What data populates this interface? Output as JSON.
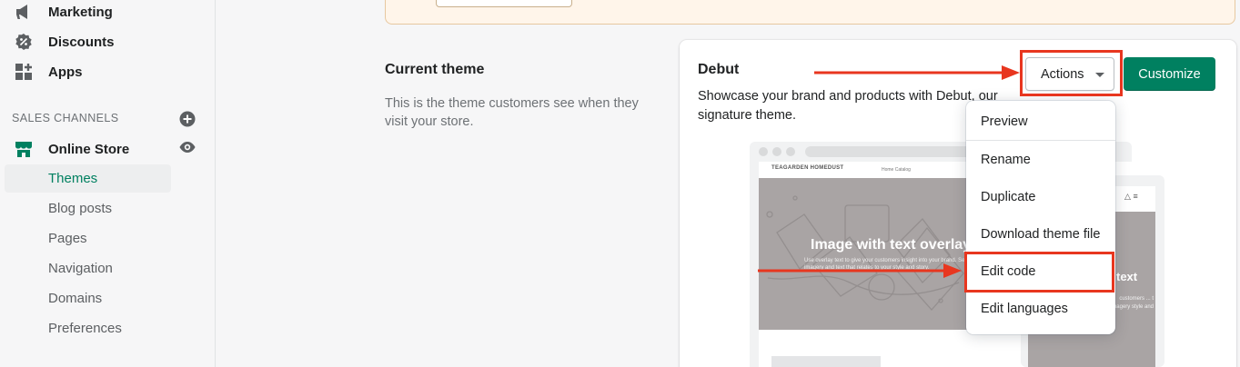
{
  "sidebar": {
    "items": [
      {
        "label": "Marketing",
        "icon": "megaphone-icon"
      },
      {
        "label": "Discounts",
        "icon": "discount-icon"
      },
      {
        "label": "Apps",
        "icon": "apps-icon"
      }
    ],
    "sales_channels_heading": "SALES CHANNELS",
    "online_store_label": "Online Store",
    "sub_items": [
      {
        "label": "Themes",
        "active": true
      },
      {
        "label": "Blog posts"
      },
      {
        "label": "Pages"
      },
      {
        "label": "Navigation"
      },
      {
        "label": "Domains"
      },
      {
        "label": "Preferences"
      }
    ]
  },
  "current_theme": {
    "title": "Current theme",
    "description": "This is the theme customers see when they visit your store."
  },
  "card": {
    "theme_name": "Debut",
    "theme_description": "Showcase your brand and products with Debut, our signature theme.",
    "actions_label": "Actions",
    "customize_label": "Customize"
  },
  "dropdown": {
    "items": [
      "Preview",
      "Rename",
      "Duplicate",
      "Download theme file",
      "Edit code",
      "Edit languages"
    ]
  },
  "preview": {
    "brand": "TEAGARDEN HOMEDUST",
    "nav_links": "Home   Catalog",
    "hero_title": "Image with text overlay",
    "hero_sub": "Use overlay text to give your customers insight into your brand. Select imagery and text that relates to your style and story.",
    "mobile_hero_title": "text",
    "mobile_hero_sub": "customers ... t imagery style and"
  },
  "colors": {
    "accent": "#008060",
    "annotation": "#e8361f",
    "banner": "#fff5ea"
  }
}
